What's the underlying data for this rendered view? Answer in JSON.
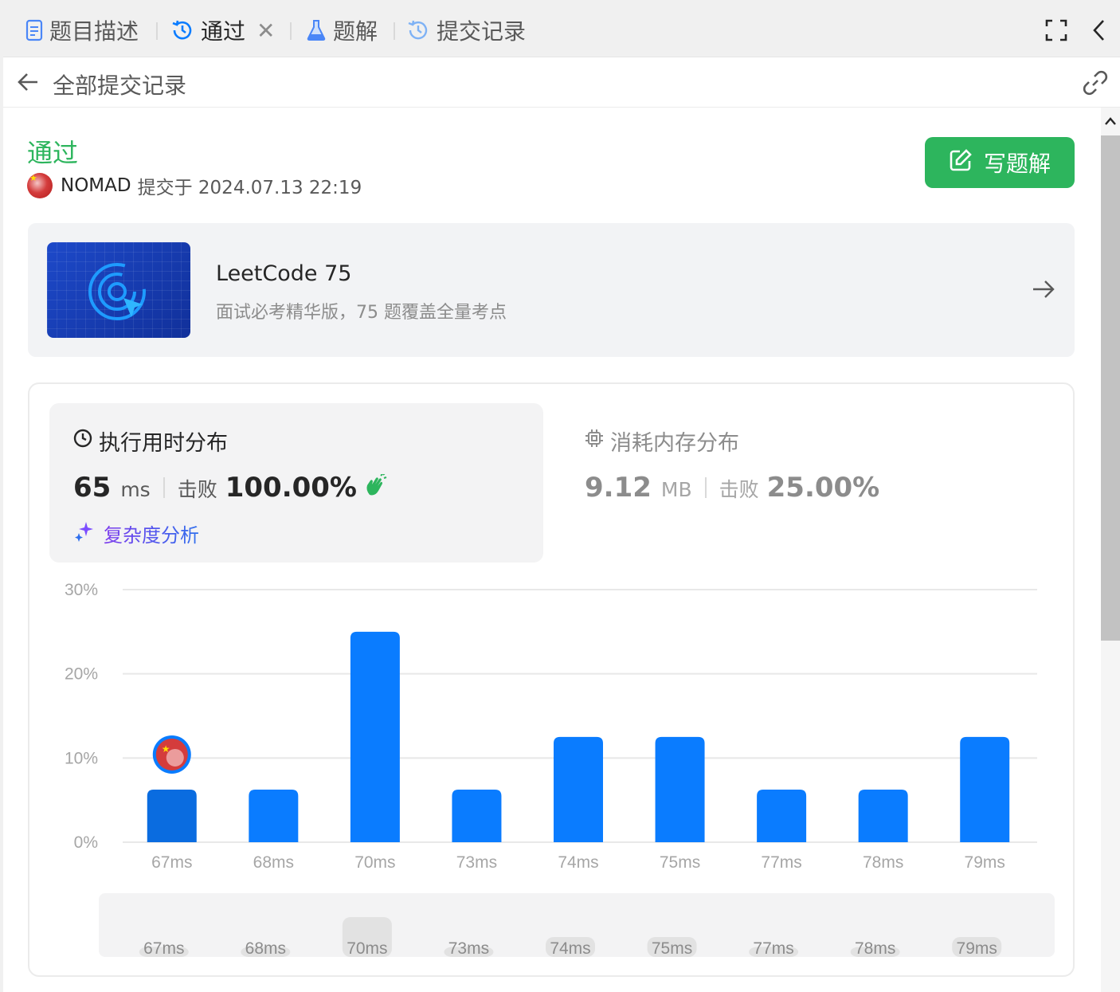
{
  "tabs": [
    {
      "label": "题目描述",
      "icon": "document-icon"
    },
    {
      "label": "通过",
      "icon": "history-icon",
      "active": true
    },
    {
      "label": "题解",
      "icon": "flask-icon"
    },
    {
      "label": "提交记录",
      "icon": "history-icon"
    }
  ],
  "subheader": {
    "title": "全部提交记录"
  },
  "submission": {
    "status": "通过",
    "author": "NOMAD",
    "submitted_text": "提交于 2024.07.13 22:19",
    "write_solution_label": "写题解"
  },
  "study_plan": {
    "title": "LeetCode 75",
    "subtitle": "面试必考精华版，75 题覆盖全量考点"
  },
  "runtime": {
    "heading": "执行用时分布",
    "value": "65",
    "unit": "ms",
    "beats_label": "击败",
    "beats_pct": "100.00%",
    "complexity_label": "复杂度分析"
  },
  "memory": {
    "heading": "消耗内存分布",
    "value": "9.12",
    "unit": "MB",
    "beats_label": "击败",
    "beats_pct": "25.00%"
  },
  "chart_data": {
    "type": "bar",
    "categories": [
      "67ms",
      "68ms",
      "70ms",
      "73ms",
      "74ms",
      "75ms",
      "77ms",
      "78ms",
      "79ms"
    ],
    "values": [
      6.25,
      6.25,
      25,
      6.25,
      12.5,
      12.5,
      6.25,
      6.25,
      12.5
    ],
    "yticks": [
      "0%",
      "10%",
      "20%",
      "30%"
    ],
    "ylim": [
      0,
      30
    ],
    "highlight_index": 0,
    "bar_color": "#0a7cff",
    "highlight_color": "#0a6ce0"
  },
  "overview": {
    "labels": [
      "67ms",
      "68ms",
      "70ms",
      "73ms",
      "74ms",
      "75ms",
      "77ms",
      "78ms",
      "79ms"
    ]
  }
}
